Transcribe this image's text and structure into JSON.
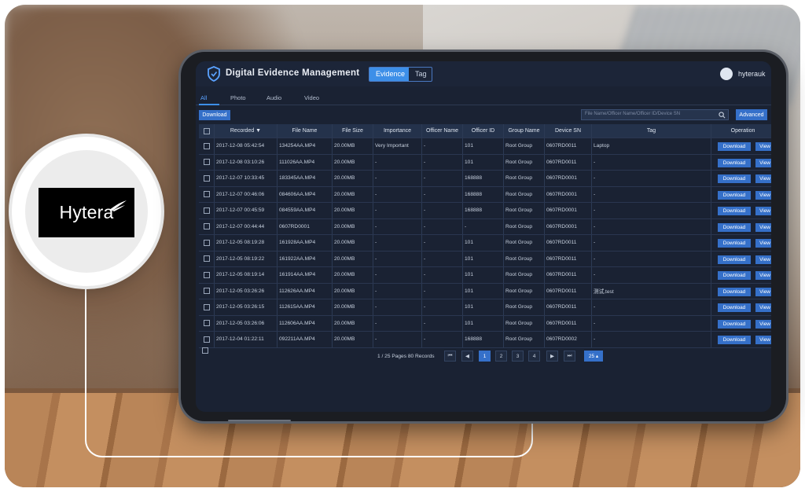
{
  "logo": {
    "text": "Hytera"
  },
  "header": {
    "title": "Digital Evidence Management",
    "toggle": [
      "Evidence",
      "Tag"
    ],
    "user": "hyterauk"
  },
  "tabs": [
    "All",
    "Photo",
    "Audio",
    "Video"
  ],
  "toolbar": {
    "download_label": "Download",
    "search_placeholder": "File Name/Officer Name/Officer ID/Device SN",
    "advanced_label": "Advanced"
  },
  "table": {
    "columns": [
      "Recorded ▼",
      "File Name",
      "File Size",
      "Importance",
      "Officer Name",
      "Officer ID",
      "Group Name",
      "Device SN",
      "Tag",
      "Operation"
    ],
    "rows": [
      [
        "2017-12-08 05:42:54",
        "134254AA.MP4",
        "20.00MB",
        "Very Important",
        "-",
        "101",
        "Root Group",
        "0607RD0011",
        "Laptop"
      ],
      [
        "2017-12-08 03:10:26",
        "111026AA.MP4",
        "20.00MB",
        "-",
        "-",
        "101",
        "Root Group",
        "0607RD0011",
        "-"
      ],
      [
        "2017-12-07 10:33:45",
        "183345AA.MP4",
        "20.00MB",
        "-",
        "-",
        "168888",
        "Root Group",
        "0607RD0001",
        "-"
      ],
      [
        "2017-12-07 00:46:06",
        "084606AA.MP4",
        "20.00MB",
        "-",
        "-",
        "168888",
        "Root Group",
        "0607RD0001",
        "-"
      ],
      [
        "2017-12-07 00:45:59",
        "084559AA.MP4",
        "20.00MB",
        "-",
        "-",
        "168888",
        "Root Group",
        "0607RD0001",
        "-"
      ],
      [
        "2017-12-07 00:44:44",
        "0607RD0001",
        "20.00MB",
        "-",
        "-",
        "-",
        "Root Group",
        "0607RD0001",
        "-"
      ],
      [
        "2017-12-05 08:19:28",
        "161928AA.MP4",
        "20.00MB",
        "-",
        "-",
        "101",
        "Root Group",
        "0607RD0011",
        "-"
      ],
      [
        "2017-12-05 08:19:22",
        "161922AA.MP4",
        "20.00MB",
        "-",
        "-",
        "101",
        "Root Group",
        "0607RD0011",
        "-"
      ],
      [
        "2017-12-05 08:19:14",
        "161914AA.MP4",
        "20.00MB",
        "-",
        "-",
        "101",
        "Root Group",
        "0607RD0011",
        "-"
      ],
      [
        "2017-12-05 03:26:26",
        "112626AA.MP4",
        "20.00MB",
        "-",
        "-",
        "101",
        "Root Group",
        "0607RD0011",
        "测试,test"
      ],
      [
        "2017-12-05 03:26:15",
        "112615AA.MP4",
        "20.00MB",
        "-",
        "-",
        "101",
        "Root Group",
        "0607RD0011",
        "-"
      ],
      [
        "2017-12-05 03:26:06",
        "112606AA.MP4",
        "20.00MB",
        "-",
        "-",
        "101",
        "Root Group",
        "0607RD0011",
        "-"
      ],
      [
        "2017-12-04 01:22:11",
        "092211AA.MP4",
        "20.00MB",
        "-",
        "-",
        "168888",
        "Root Group",
        "0607RD0002",
        "-"
      ]
    ],
    "op_download": "Download",
    "op_view": "View"
  },
  "pager": {
    "info": "1 / 25 Pages 80 Records",
    "first": "⏮",
    "prev": "◀",
    "pages": [
      "1",
      "2",
      "3",
      "4"
    ],
    "current": "1",
    "next": "▶",
    "last": "⏭",
    "page_size": "25 ▴"
  },
  "colors": {
    "screen_bg": "#1a2233",
    "accent": "#3570c9",
    "active_tab": "#3d8fe8"
  }
}
